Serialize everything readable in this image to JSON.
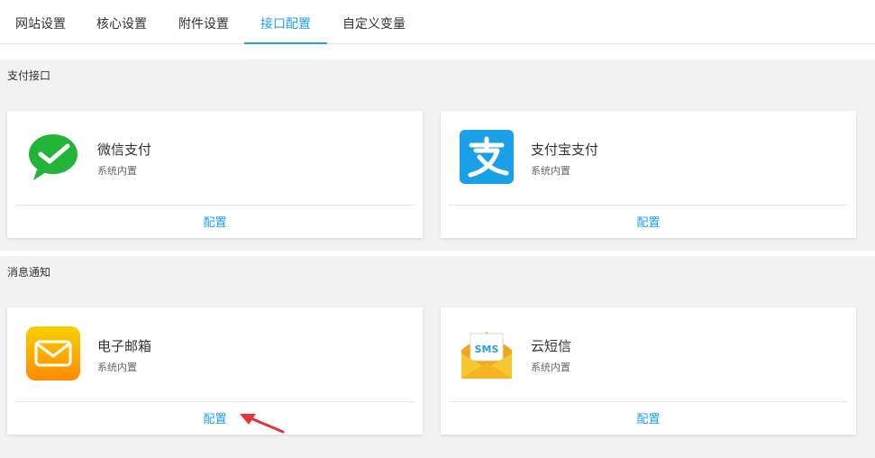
{
  "tabs": [
    {
      "label": "网站设置"
    },
    {
      "label": "核心设置"
    },
    {
      "label": "附件设置"
    },
    {
      "label": "接口配置",
      "active": true
    },
    {
      "label": "自定义变量"
    }
  ],
  "sections": {
    "payment": {
      "title": "支付接口",
      "cards": [
        {
          "name": "微信支付",
          "sub": "系统内置",
          "action": "配置",
          "icon": "wechat-pay-icon"
        },
        {
          "name": "支付宝支付",
          "sub": "系统内置",
          "action": "配置",
          "icon": "alipay-icon"
        }
      ]
    },
    "notify": {
      "title": "消息通知",
      "cards": [
        {
          "name": "电子邮箱",
          "sub": "系统内置",
          "action": "配置",
          "icon": "email-icon"
        },
        {
          "name": "云短信",
          "sub": "系统内置",
          "action": "配置",
          "icon": "sms-icon",
          "icon_text": "SMS"
        }
      ]
    }
  },
  "colors": {
    "accent": "#1e9fff",
    "wechat": "#22b339",
    "alipay": "#1aa0e7",
    "email_top": "#f8d100",
    "email_bottom": "#ff8a00",
    "arrow": "#e8323c"
  },
  "annotation": {
    "type": "red-arrow",
    "points_to": "email-config-button"
  }
}
